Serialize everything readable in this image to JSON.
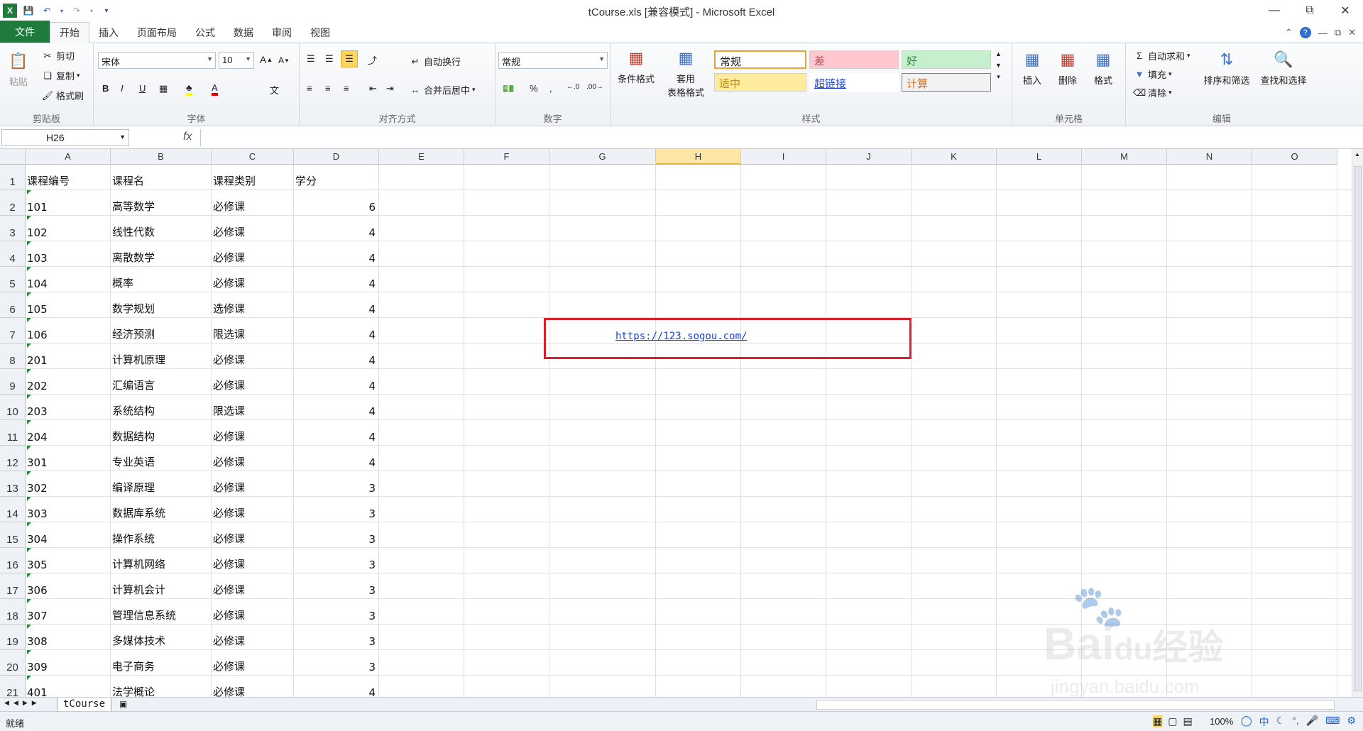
{
  "window": {
    "title": "tCourse.xls  [兼容模式] - Microsoft Excel",
    "min_icon": "minimize-icon",
    "max_icon": "restore-icon",
    "close_icon": "close-icon"
  },
  "tabs": [
    "文件",
    "开始",
    "插入",
    "页面布局",
    "公式",
    "数据",
    "审阅",
    "视图"
  ],
  "active_tab": "开始",
  "ribbon": {
    "clipboard": {
      "label": "剪贴板",
      "paste": "粘贴",
      "cut": "剪切",
      "copy": "复制",
      "format_painter": "格式刷"
    },
    "font": {
      "label": "字体",
      "name": "宋体",
      "size": "10"
    },
    "align": {
      "label": "对齐方式",
      "wrap": "自动换行",
      "merge": "合并后居中"
    },
    "number": {
      "label": "数字",
      "format": "常规"
    },
    "styles": {
      "label": "样式",
      "cond": "条件格式",
      "table_1": "套用",
      "table_2": "表格格式",
      "normal": "常规",
      "bad": "差",
      "good": "好",
      "neutral": "适中",
      "hyperlink": "超链接",
      "calc": "计算"
    },
    "cells": {
      "label": "单元格",
      "insert": "插入",
      "delete": "删除",
      "format": "格式"
    },
    "editing": {
      "label": "编辑",
      "autosum": "自动求和",
      "fill": "填充",
      "clear": "清除",
      "sort": "排序和筛选",
      "find": "查找和选择"
    }
  },
  "formula_bar": {
    "name_box": "H26",
    "fx": "fx",
    "content": ""
  },
  "columns": [
    "A",
    "B",
    "C",
    "D",
    "E",
    "F",
    "G",
    "H",
    "I",
    "J",
    "K",
    "L",
    "M",
    "N",
    "O"
  ],
  "selected_column": "H",
  "rows": [
    [
      "课程编号",
      "课程名",
      "课程类别",
      "学分"
    ],
    [
      "101",
      "高等数学",
      "必修课",
      "6"
    ],
    [
      "102",
      "线性代数",
      "必修课",
      "4"
    ],
    [
      "103",
      "离散数学",
      "必修课",
      "4"
    ],
    [
      "104",
      "概率",
      "必修课",
      "4"
    ],
    [
      "105",
      "数学规划",
      "选修课",
      "4"
    ],
    [
      "106",
      "经济预测",
      "限选课",
      "4"
    ],
    [
      "201",
      "计算机原理",
      "必修课",
      "4"
    ],
    [
      "202",
      "汇编语言",
      "必修课",
      "4"
    ],
    [
      "203",
      "系统结构",
      "限选课",
      "4"
    ],
    [
      "204",
      "数据结构",
      "必修课",
      "4"
    ],
    [
      "301",
      "专业英语",
      "必修课",
      "4"
    ],
    [
      "302",
      "编译原理",
      "必修课",
      "3"
    ],
    [
      "303",
      "数据库系统",
      "必修课",
      "3"
    ],
    [
      "304",
      "操作系统",
      "必修课",
      "3"
    ],
    [
      "305",
      "计算机网络",
      "必修课",
      "3"
    ],
    [
      "306",
      "计算机会计",
      "必修课",
      "3"
    ],
    [
      "307",
      "管理信息系统",
      "必修课",
      "3"
    ],
    [
      "308",
      "多媒体技术",
      "必修课",
      "3"
    ],
    [
      "309",
      "电子商务",
      "必修课",
      "3"
    ],
    [
      "401",
      "法学概论",
      "必修课",
      "4"
    ]
  ],
  "hyperlink": "https://123.sogou.com/",
  "sheet_tab": "tCourse",
  "status": {
    "ready": "就绪",
    "zoom": "100%"
  },
  "watermark": {
    "brand": "Bai",
    "brand2": "du",
    "cn": "经验",
    "url": "jingyan.baidu.com"
  }
}
